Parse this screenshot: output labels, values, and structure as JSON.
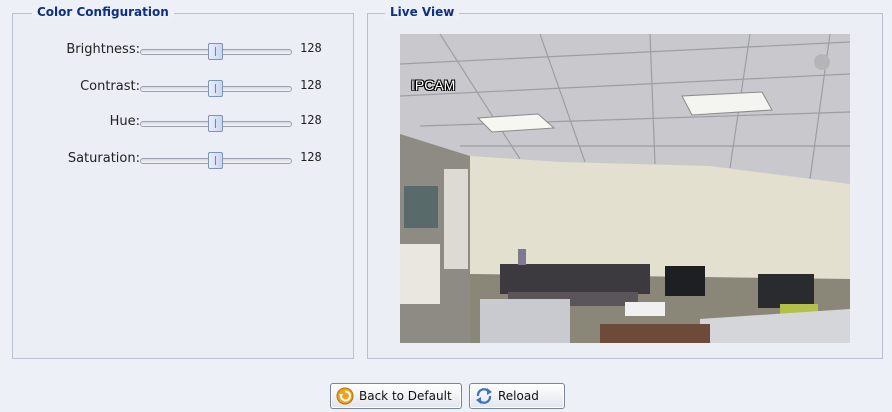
{
  "color_configuration": {
    "title": "Color Configuration",
    "sliders": [
      {
        "label": "Brightness:",
        "value": "128",
        "fraction": 0.5
      },
      {
        "label": "Contrast:",
        "value": "128",
        "fraction": 0.5
      },
      {
        "label": "Hue:",
        "value": "128",
        "fraction": 0.5
      },
      {
        "label": "Saturation:",
        "value": "128",
        "fraction": 0.5
      }
    ]
  },
  "live_view": {
    "title": "Live View",
    "osd_text": "IPCAM"
  },
  "buttons": {
    "back_to_default": "Back to Default",
    "reload": "Reload"
  },
  "colors": {
    "legend_text": "#0d2f86",
    "panel_border": "#b9c0cf",
    "background": "#eef0f7"
  },
  "icons": {
    "back_to_default": "undo-arrow-icon",
    "reload": "refresh-icon"
  }
}
